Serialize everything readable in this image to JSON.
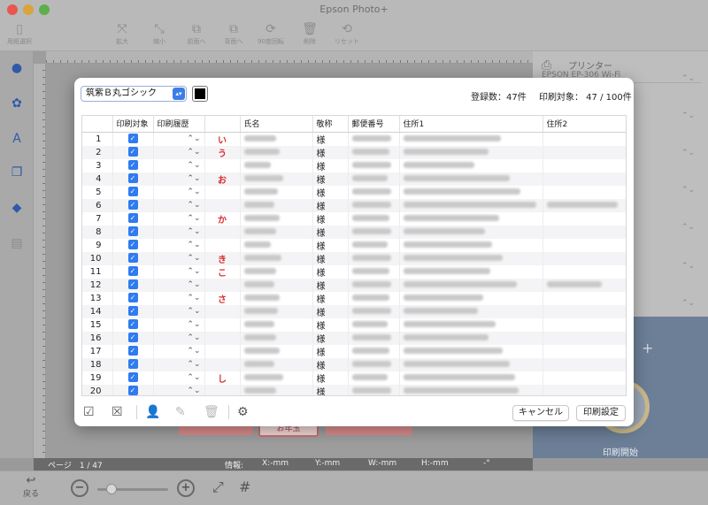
{
  "window": {
    "title": "Epson Photo+"
  },
  "toolbar": {
    "buttons": [
      {
        "label": "用紙選択",
        "icon": "paper-icon"
      },
      {
        "label": "拡大",
        "icon": "expand-icon"
      },
      {
        "label": "縮小",
        "icon": "shrink-icon"
      },
      {
        "label": "前面へ",
        "icon": "bring-front-icon"
      },
      {
        "label": "背面へ",
        "icon": "send-back-icon"
      },
      {
        "label": "90度回転",
        "icon": "rotate-icon"
      },
      {
        "label": "削除",
        "icon": "trash-icon"
      },
      {
        "label": "リセット",
        "icon": "reset-icon"
      }
    ]
  },
  "modal": {
    "font": "筑紫Ｂ丸ゴシック",
    "font_color": "#000000",
    "registered_count": "登録数：47件",
    "print_target": "印刷対象： 47 / 100件",
    "columns": [
      "",
      "印刷対象",
      "印刷履歴",
      "",
      "氏名",
      "敬称",
      "郵便番号",
      "住所1",
      "住所2"
    ],
    "rows": [
      {
        "no": "1",
        "kana": "い",
        "honorific": "様"
      },
      {
        "no": "2",
        "kana": "う",
        "honorific": "様"
      },
      {
        "no": "3",
        "kana": "",
        "honorific": "様"
      },
      {
        "no": "4",
        "kana": "お",
        "honorific": "様"
      },
      {
        "no": "5",
        "kana": "",
        "honorific": "様"
      },
      {
        "no": "6",
        "kana": "",
        "honorific": "様"
      },
      {
        "no": "7",
        "kana": "か",
        "honorific": "様"
      },
      {
        "no": "8",
        "kana": "",
        "honorific": "様"
      },
      {
        "no": "9",
        "kana": "",
        "honorific": "様"
      },
      {
        "no": "10",
        "kana": "き",
        "honorific": "様"
      },
      {
        "no": "11",
        "kana": "こ",
        "honorific": "様"
      },
      {
        "no": "12",
        "kana": "",
        "honorific": "様"
      },
      {
        "no": "13",
        "kana": "さ",
        "honorific": "様"
      },
      {
        "no": "14",
        "kana": "",
        "honorific": "様"
      },
      {
        "no": "15",
        "kana": "",
        "honorific": "様"
      },
      {
        "no": "16",
        "kana": "",
        "honorific": "様"
      },
      {
        "no": "17",
        "kana": "",
        "honorific": "様"
      },
      {
        "no": "18",
        "kana": "",
        "honorific": "様"
      },
      {
        "no": "19",
        "kana": "し",
        "honorific": "様"
      },
      {
        "no": "20",
        "kana": "",
        "honorific": "様"
      }
    ],
    "cancel_label": "キャンセル",
    "print_settings_label": "印刷設定"
  },
  "right_panel": {
    "printer_label": "プリンター",
    "printer_name": "EPSON EP-306 Wi-Fi",
    "start_label": "印刷開始"
  },
  "canvas": {
    "paper_label": "お年玉"
  },
  "status_bar": {
    "page": "ページ　1 / 47",
    "info": "情報:",
    "x": "X:-mm",
    "y": "Y:-mm",
    "w": "W:-mm",
    "h": "H:-mm",
    "angle": "-°"
  },
  "bottom_bar": {
    "back_label": "戻る"
  },
  "colors": {
    "accent": "#2f7bf0",
    "kana_red": "#d92b2b",
    "start_panel": "#6c7f97"
  }
}
